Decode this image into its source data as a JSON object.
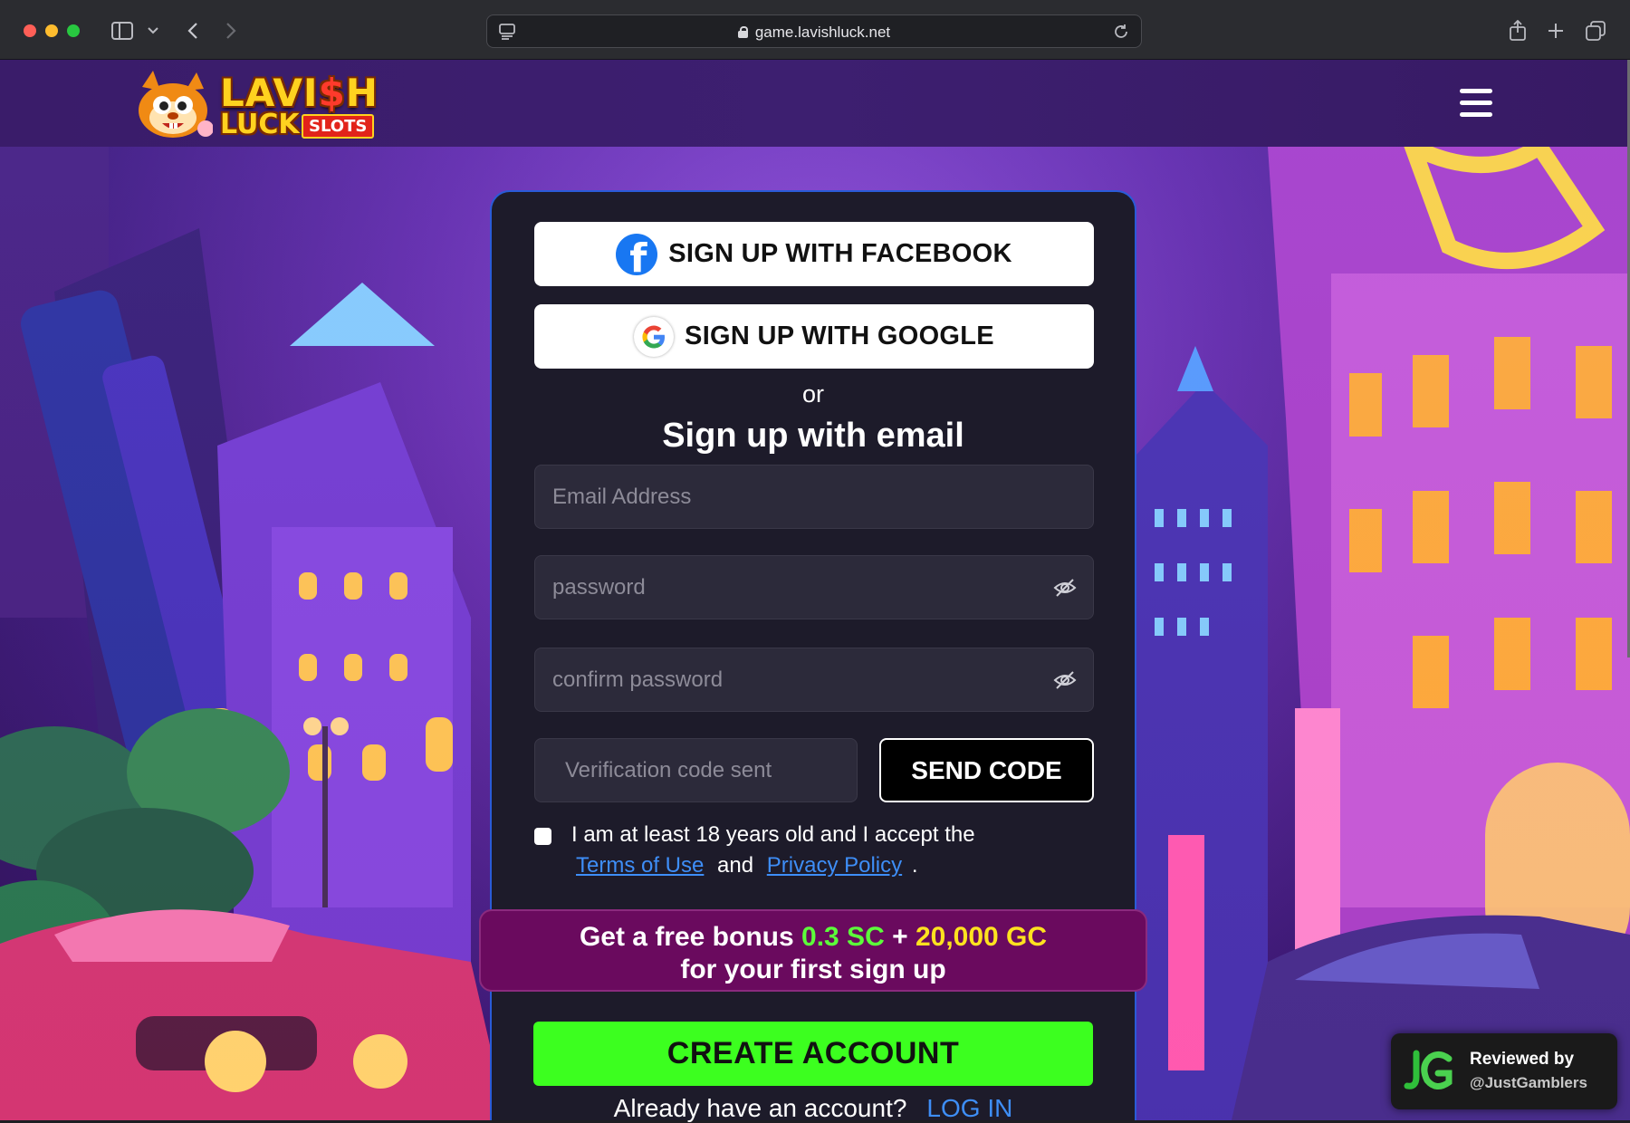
{
  "browser": {
    "url": "game.lavishluck.net"
  },
  "header": {
    "logo_line1_a": "LAVI",
    "logo_line1_dollar": "$",
    "logo_line1_b": "H",
    "logo_line2": "LUCK",
    "logo_badge": "SLOTS"
  },
  "form": {
    "facebook_label": "SIGN UP WITH FACEBOOK",
    "google_label": "SIGN UP WITH GOOGLE",
    "or_text": "or",
    "heading": "Sign up with email",
    "email_placeholder": "Email Address",
    "password_placeholder": "password",
    "confirm_placeholder": "confirm password",
    "code_placeholder": "Verification code sent",
    "send_code_label": "SEND CODE",
    "agree_text": "I am at least 18 years old and I accept the",
    "terms_link": "Terms of Use",
    "and_text": "and",
    "privacy_link": "Privacy Policy",
    "period": ".",
    "bonus_prefix": "Get a free bonus",
    "bonus_sc": "0.3 SC",
    "bonus_plus": "+",
    "bonus_gc": "20,000 GC",
    "bonus_line2": "for your first sign up",
    "create_label": "CREATE ACCOUNT",
    "already_text": "Already have an account?",
    "login_link": "LOG IN"
  },
  "badge": {
    "line1": "Reviewed by",
    "line2": "@JustGamblers"
  },
  "colors": {
    "accent_green": "#3cff1f",
    "link_blue": "#3e8ef7",
    "bonus_bg": "#6a0a5e",
    "panel_bg": "#1d1b2a"
  },
  "icons": [
    "sidebar-icon",
    "chevron-down-icon",
    "back-icon",
    "forward-icon",
    "reader-icon",
    "lock-icon",
    "reload-icon",
    "share-icon",
    "new-tab-icon",
    "tabs-icon",
    "hamburger-menu-icon",
    "facebook-icon",
    "google-icon",
    "eye-off-icon"
  ]
}
